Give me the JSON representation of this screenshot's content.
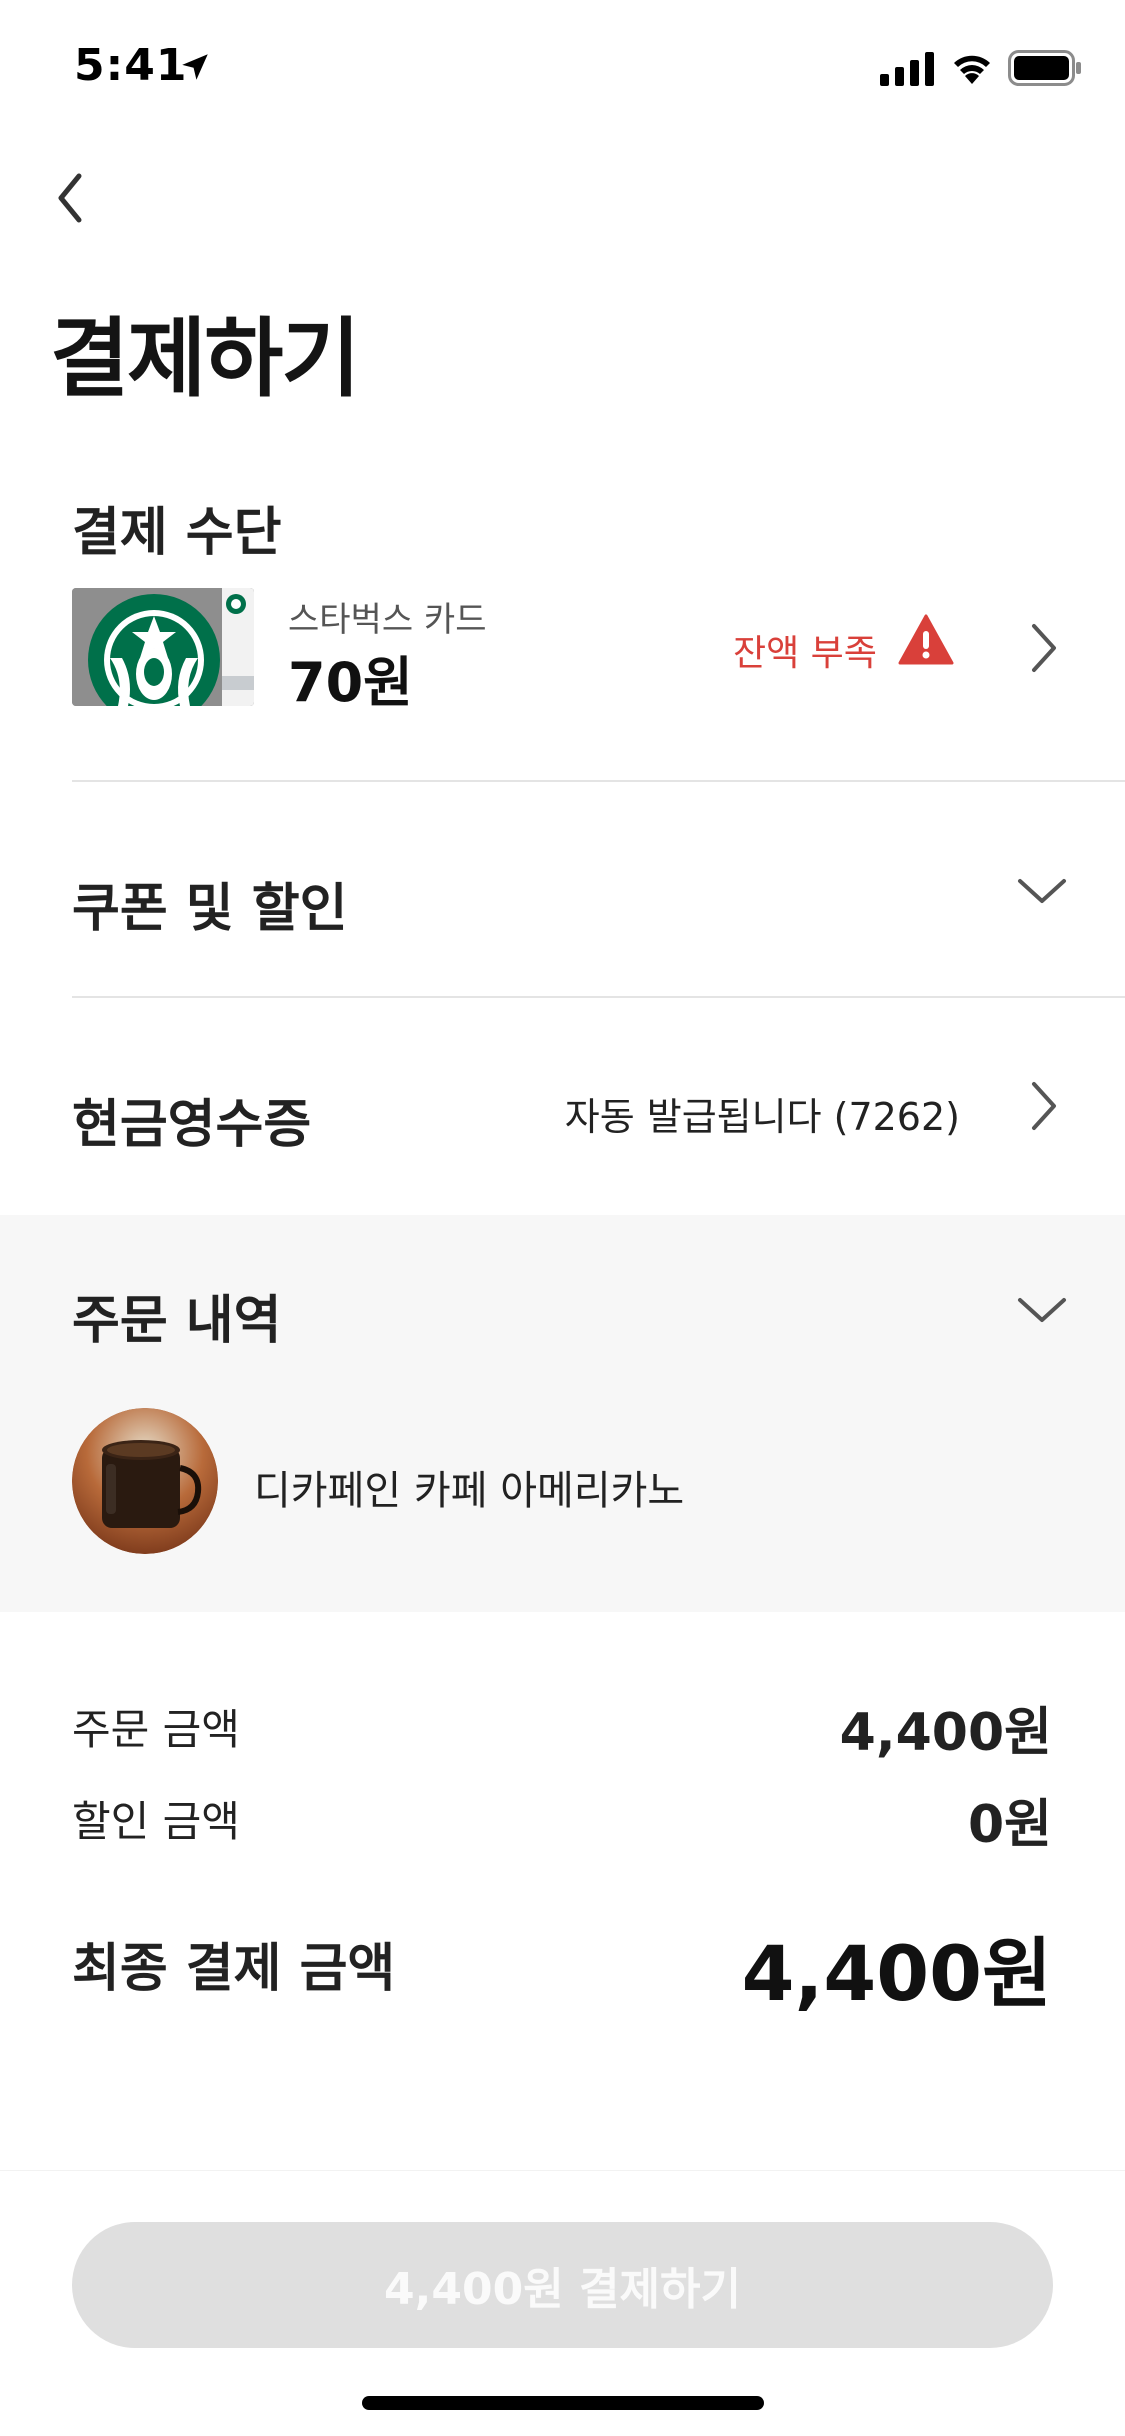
{
  "status_bar": {
    "time": "5:41"
  },
  "header": {
    "title": "결제하기"
  },
  "payment_method": {
    "title": "결제 수단",
    "card_name": "스타벅스 카드",
    "balance": "70원",
    "warning": "잔액 부족"
  },
  "coupon": {
    "title": "쿠폰 및 할인"
  },
  "receipt": {
    "title": "현금영수증",
    "value": "자동 발급됩니다 (7262)"
  },
  "order": {
    "title": "주문 내역",
    "items": [
      {
        "name": "디카페인 카페 아메리카노"
      }
    ]
  },
  "amounts": {
    "order_label": "주문 금액",
    "order_value": "4,400원",
    "discount_label": "할인 금액",
    "discount_value": "0원",
    "final_label": "최종 결제 금액",
    "final_value": "4,400원"
  },
  "pay_button": {
    "label": "4,400원 결제하기"
  },
  "colors": {
    "warning": "#d9403a",
    "starbucks_green": "#00704a",
    "button_disabled": "#dfdfdf",
    "order_bg": "#f7f7f7"
  },
  "icons": [
    "location-arrow-icon",
    "signal-icon",
    "wifi-icon",
    "battery-icon",
    "back-chevron-icon",
    "warning-triangle-icon",
    "chevron-right-icon",
    "chevron-down-icon"
  ]
}
